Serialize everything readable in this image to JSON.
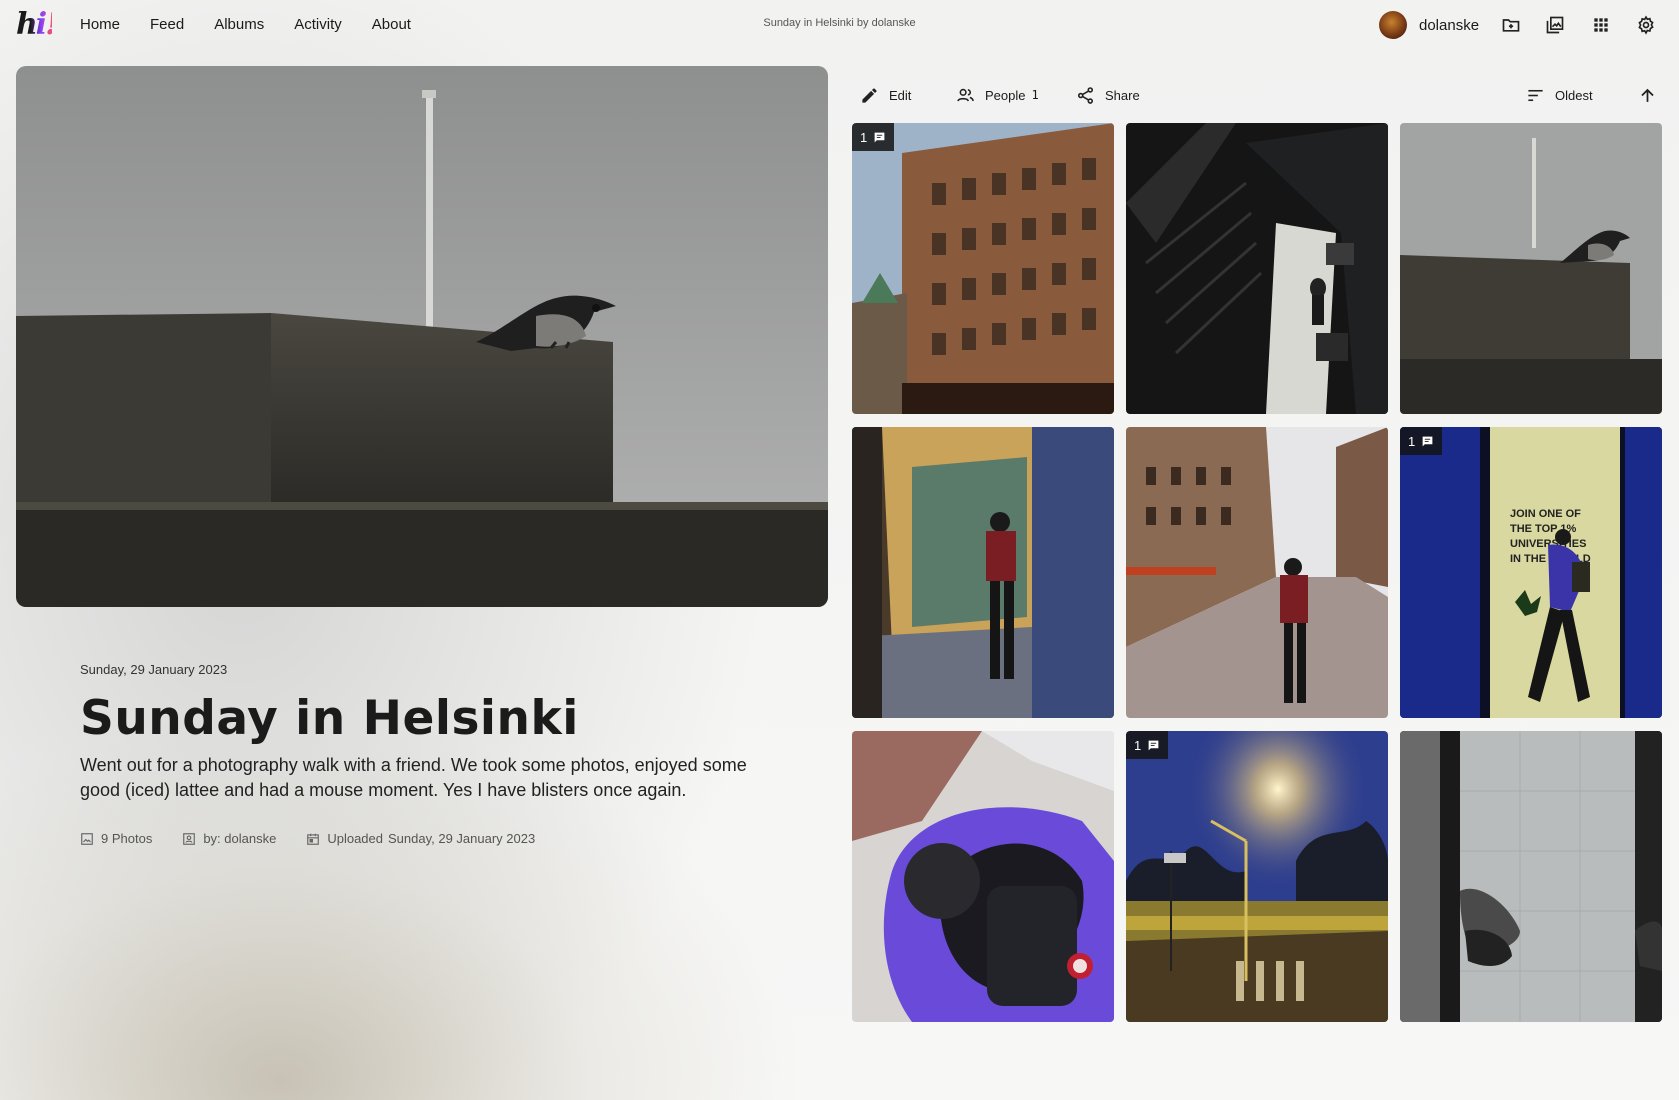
{
  "app": {
    "logo_text": "hi!"
  },
  "nav": [
    {
      "label": "Home"
    },
    {
      "label": "Feed"
    },
    {
      "label": "Albums"
    },
    {
      "label": "Activity"
    },
    {
      "label": "About"
    }
  ],
  "header": {
    "breadcrumb": "Sunday in Helsinki by dolanske"
  },
  "user": {
    "name": "dolanske"
  },
  "top_icons": [
    "add-folder-icon",
    "gallery-icon",
    "apps-grid-icon",
    "settings-icon"
  ],
  "album": {
    "date": "Sunday, 29 January 2023",
    "title": "Sunday in Helsinki",
    "description": "Went out for a photography walk with a friend. We took some photos, enjoyed some good (iced) lattee and had a mouse moment. Yes I have blisters once again.",
    "photo_count": "9 Photos",
    "author": "by: dolanske",
    "uploaded_label": "Uploaded",
    "uploaded_date": "Sunday, 29 January 2023"
  },
  "toolbar": {
    "edit_label": "Edit",
    "people_label": "People",
    "people_count": "1",
    "share_label": "Share",
    "sort_label": "Oldest"
  },
  "photos": [
    {
      "scene": "building",
      "comments": "1"
    },
    {
      "scene": "escalator",
      "comments": ""
    },
    {
      "scene": "crow",
      "comments": ""
    },
    {
      "scene": "window-man",
      "comments": ""
    },
    {
      "scene": "street",
      "comments": ""
    },
    {
      "scene": "poster-walker",
      "comments": "1"
    },
    {
      "scene": "top-down",
      "comments": ""
    },
    {
      "scene": "tram-dusk",
      "comments": "1"
    },
    {
      "scene": "shadow",
      "comments": ""
    }
  ],
  "colors": {
    "accent": "#1b1b1b",
    "badge_bg": "#141414",
    "page_bg": "#f7f7f6"
  }
}
